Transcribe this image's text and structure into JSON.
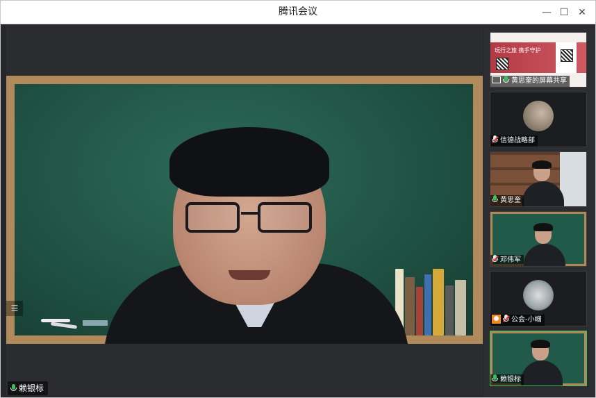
{
  "window": {
    "title": "腾讯会议",
    "minimize_glyph": "—",
    "maximize_glyph": "☐",
    "close_glyph": "✕"
  },
  "main": {
    "speaker_name": "赖银标",
    "side_handle_glyph": "☰"
  },
  "participants": [
    {
      "label": "黄思奎的屏幕共享",
      "type": "screen-share",
      "share_title": "玩行之旅  携手守护",
      "muted": false
    },
    {
      "label": "信德战略部",
      "type": "avatar",
      "muted": true
    },
    {
      "label": "黄思奎",
      "type": "video",
      "muted": false
    },
    {
      "label": "邓伟军",
      "type": "video",
      "muted": true
    },
    {
      "label": "公会-小帼",
      "type": "avatar",
      "muted": true
    },
    {
      "label": "赖银标",
      "type": "video",
      "muted": false,
      "active": true
    }
  ],
  "colors": {
    "mic_active": "#3cc05a",
    "mic_muted_slash": "#e03b3b",
    "active_border": "#3cc05a",
    "board_green": "#1f5142",
    "frame_wood": "#b08a5a"
  }
}
